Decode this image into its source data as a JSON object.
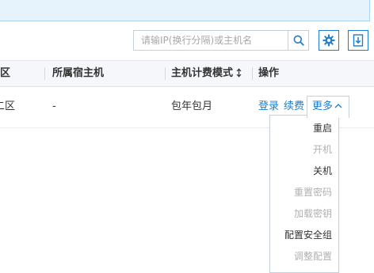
{
  "toolbar": {
    "search_placeholder": "请输IP(换行分隔)或主机名",
    "search_icon": "search-icon",
    "settings_icon": "gear-icon",
    "download_icon": "download-icon"
  },
  "table": {
    "columns": [
      "区",
      "所属宿主机",
      "主机计费模式",
      "操作"
    ],
    "rows": [
      {
        "zone": "二区",
        "host": "-",
        "billing": "包年包月",
        "actions": {
          "login": "登录",
          "renew": "续费",
          "more": "更多"
        }
      }
    ]
  },
  "more_menu": {
    "items": [
      {
        "label": "重启",
        "enabled": true
      },
      {
        "label": "开机",
        "enabled": false
      },
      {
        "label": "关机",
        "enabled": true
      },
      {
        "label": "重置密码",
        "enabled": false
      },
      {
        "label": "加载密钥",
        "enabled": false
      },
      {
        "label": "配置安全组",
        "enabled": true
      },
      {
        "label": "调整配置",
        "enabled": false
      }
    ]
  },
  "colors": {
    "accent": "#1e7ccd",
    "banner_bg": "#e6f3fd",
    "disabled_text": "#b0b0b0"
  }
}
